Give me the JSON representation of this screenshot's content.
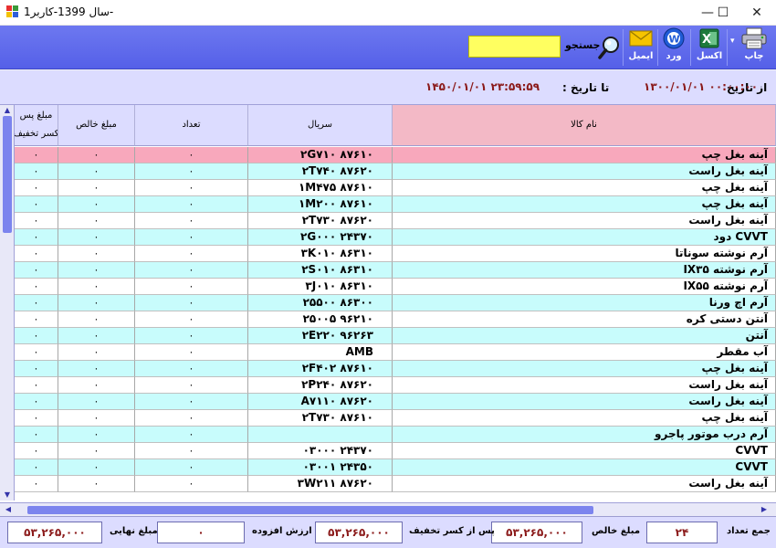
{
  "window": {
    "title": "سال 1399-کاربر1-",
    "minimize_glyph": "—",
    "maximize_glyph": "☐",
    "close_glyph": "✕"
  },
  "toolbar": {
    "print_label": "چاپ",
    "print_dropdown_glyph": "▾",
    "excel_label": "اکسل",
    "word_label": "ورد",
    "email_label": "ایمیل",
    "search_label": "جستجو",
    "search_value": "",
    "icons": {
      "print": "printer-icon",
      "excel": "excel-icon",
      "word": "word-icon",
      "email": "envelope-icon",
      "search": "magnifier-icon"
    }
  },
  "date_bar": {
    "from_label": "از تاریخ",
    "from_value": "۱۳۰۰/۰۱/۰۱ ۰۰:۰۰:۰۰",
    "to_label": "تا تاریخ :",
    "to_value": "۱۴۵۰/۰۱/۰۱ ۲۳:۵۹:۵۹"
  },
  "grid": {
    "columns": {
      "name": "نام کالا",
      "serial": "سریال",
      "count": "تعداد",
      "net": "مبلغ خالص",
      "net_after_discount": "مبلغ پس از کسر تخفیف"
    },
    "net_after_discount_visible_line1": "مبلغ پس",
    "net_after_discount_visible_line2": "کسر تخفیف",
    "rows": [
      {
        "name": "آینه بغل چپ",
        "serial": "۸۷۶۱۰ ۲G۷۱۰",
        "count": "۰",
        "net": "۰",
        "net2": "۰"
      },
      {
        "name": "آینه بغل راست",
        "serial": "۸۷۶۲۰ ۲T۷۴۰",
        "count": "۰",
        "net": "۰",
        "net2": "۰"
      },
      {
        "name": "آینه بغل چپ",
        "serial": "۸۷۶۱۰ ۱M۴۷۵",
        "count": "۰",
        "net": "۰",
        "net2": "۰"
      },
      {
        "name": "آینه بغل چپ",
        "serial": "۸۷۶۱۰ ۱M۲۰۰",
        "count": "۰",
        "net": "۰",
        "net2": "۰"
      },
      {
        "name": "آینه بغل راست",
        "serial": "۸۷۶۲۰ ۲T۷۳۰",
        "count": "۰",
        "net": "۰",
        "net2": "۰"
      },
      {
        "name": "CVVT دود",
        "serial": "۲۴۳۷۰ ۲G۰۰۰",
        "count": "۰",
        "net": "۰",
        "net2": "۰"
      },
      {
        "name": "آرم نوشته سوناتا",
        "serial": "۸۶۳۱۰ ۳K۰۱۰",
        "count": "۰",
        "net": "۰",
        "net2": "۰"
      },
      {
        "name": "آرم نوشته IX۳۵",
        "serial": "۸۶۳۱۰ ۲S۰۱۰",
        "count": "۰",
        "net": "۰",
        "net2": "۰"
      },
      {
        "name": "آرم نوشته IX۵۵",
        "serial": "۸۶۳۱۰ ۳J۰۱۰",
        "count": "۰",
        "net": "۰",
        "net2": "۰"
      },
      {
        "name": "آرم اچ ورنا",
        "serial": "۸۶۳۰۰ ۲۵۵۰۰",
        "count": "۰",
        "net": "۰",
        "net2": "۰"
      },
      {
        "name": "آنتن دستی کره",
        "serial": "۹۶۲۱۰ ۲۵۰۰۵",
        "count": "۰",
        "net": "۰",
        "net2": "۰"
      },
      {
        "name": "آنتن",
        "serial": "۹۶۲۶۳ ۲E۲۲۰",
        "count": "۰",
        "net": "۰",
        "net2": "۰"
      },
      {
        "name": "آب مقطر",
        "serial": "AMB",
        "count": "۰",
        "net": "۰",
        "net2": "۰"
      },
      {
        "name": "آینه بغل چپ",
        "serial": "۸۷۶۱۰ ۲F۴۰۲",
        "count": "۰",
        "net": "۰",
        "net2": "۰"
      },
      {
        "name": "آینه بغل راست",
        "serial": "۸۷۶۲۰ ۲P۲۴۰",
        "count": "۰",
        "net": "۰",
        "net2": "۰"
      },
      {
        "name": "آینه بغل راست",
        "serial": "A۷۱۱۰ ۸۷۶۲۰",
        "count": "۰",
        "net": "۰",
        "net2": "۰"
      },
      {
        "name": "آینه بغل چپ",
        "serial": "۸۷۶۱۰ ۲T۷۳۰",
        "count": "۰",
        "net": "۰",
        "net2": "۰"
      },
      {
        "name": "آرم درب موتور پاجرو",
        "serial": "",
        "count": "۰",
        "net": "۰",
        "net2": "۰"
      },
      {
        "name": "CVVT",
        "serial": "۲۴۳۷۰ ۰۳۰۰۰",
        "count": "۰",
        "net": "۰",
        "net2": "۰"
      },
      {
        "name": "CVVT",
        "serial": "۲۴۳۵۰ ۰۳۰۰۱",
        "count": "۰",
        "net": "۰",
        "net2": "۰"
      },
      {
        "name": "آینه بغل راست",
        "serial": "۸۷۶۲۰ ۳W۲۱۱",
        "count": "۰",
        "net": "۰",
        "net2": "۰"
      }
    ],
    "row_colors": {
      "selected": "#f8a8bc",
      "alt_a": "#c8fcfc",
      "alt_b": "#ffffff"
    }
  },
  "footer": {
    "total_count_label": "جمع تعداد",
    "total_count_value": "۲۴",
    "net_amount_label": "مبلغ خالص",
    "net_amount_value": "۵۳,۲۶۵,۰۰۰",
    "after_discount_label": "پس از کسر تخفیف",
    "after_discount_value": "۵۳,۲۶۵,۰۰۰",
    "vat_label": "ارزش افزوده",
    "vat_value": "۰",
    "final_amount_label": "مبلغ نهایی",
    "final_amount_value": "۵۳,۲۶۵,۰۰۰"
  }
}
